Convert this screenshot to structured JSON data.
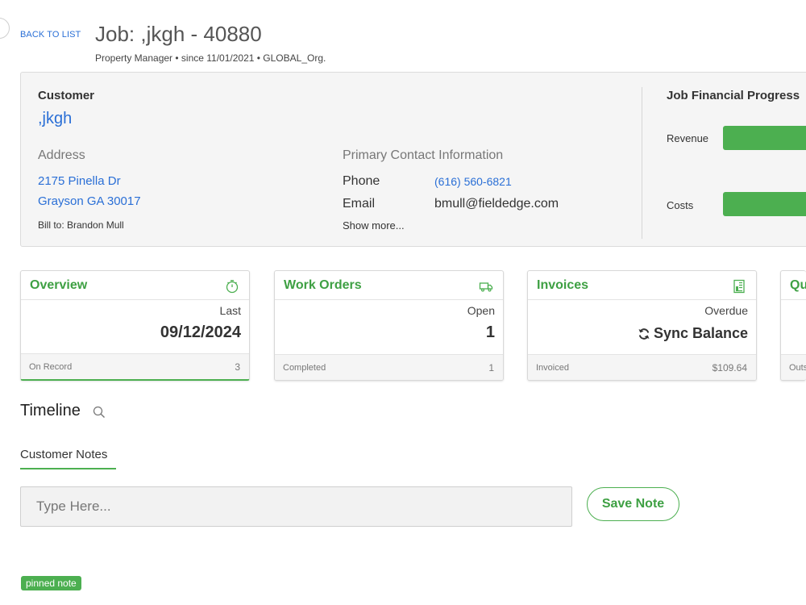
{
  "header": {
    "back_label": "BACK TO LIST",
    "title": "Job: ,jkgh - 40880",
    "subtitle": "Property Manager • since 11/01/2021 • GLOBAL_Org."
  },
  "customer": {
    "section_label": "Customer",
    "name": ",jkgh",
    "address_label": "Address",
    "address_line1": "2175 Pinella Dr",
    "address_line2": "Grayson GA 30017",
    "bill_to": "Bill to: Brandon Mull"
  },
  "contact": {
    "section_label": "Primary Contact Information",
    "phone_label": "Phone",
    "phone": "(616) 560-6821",
    "email_label": "Email",
    "email": "bmull@fieldedge.com",
    "show_more": "Show more..."
  },
  "financial": {
    "title": "Job Financial Progress",
    "revenue_label": "Revenue",
    "costs_label": "Costs",
    "bar_color": "#4caf50"
  },
  "cards": {
    "overview": {
      "title": "Overview",
      "icon": "stopwatch-icon",
      "sublabel": "Last",
      "value": "09/12/2024",
      "foot_label": "On Record",
      "foot_value": "3"
    },
    "work_orders": {
      "title": "Work Orders",
      "icon": "truck-icon",
      "sublabel": "Open",
      "value": "1",
      "foot_label": "Completed",
      "foot_value": "1"
    },
    "invoices": {
      "title": "Invoices",
      "icon": "invoice-icon",
      "sublabel": "Overdue",
      "value_icon": "sync-icon",
      "value": "Sync Balance",
      "foot_label": "Invoiced",
      "foot_value": "$109.64"
    },
    "quotes": {
      "title": "Qu",
      "foot_label": "Outs"
    }
  },
  "timeline": {
    "title": "Timeline",
    "tab_notes": "Customer Notes",
    "note_placeholder": "Type Here...",
    "save_label": "Save Note",
    "pinned_badge": "pinned note"
  },
  "colors": {
    "accent_green": "#4caf50",
    "link_blue": "#2a6fd6"
  }
}
